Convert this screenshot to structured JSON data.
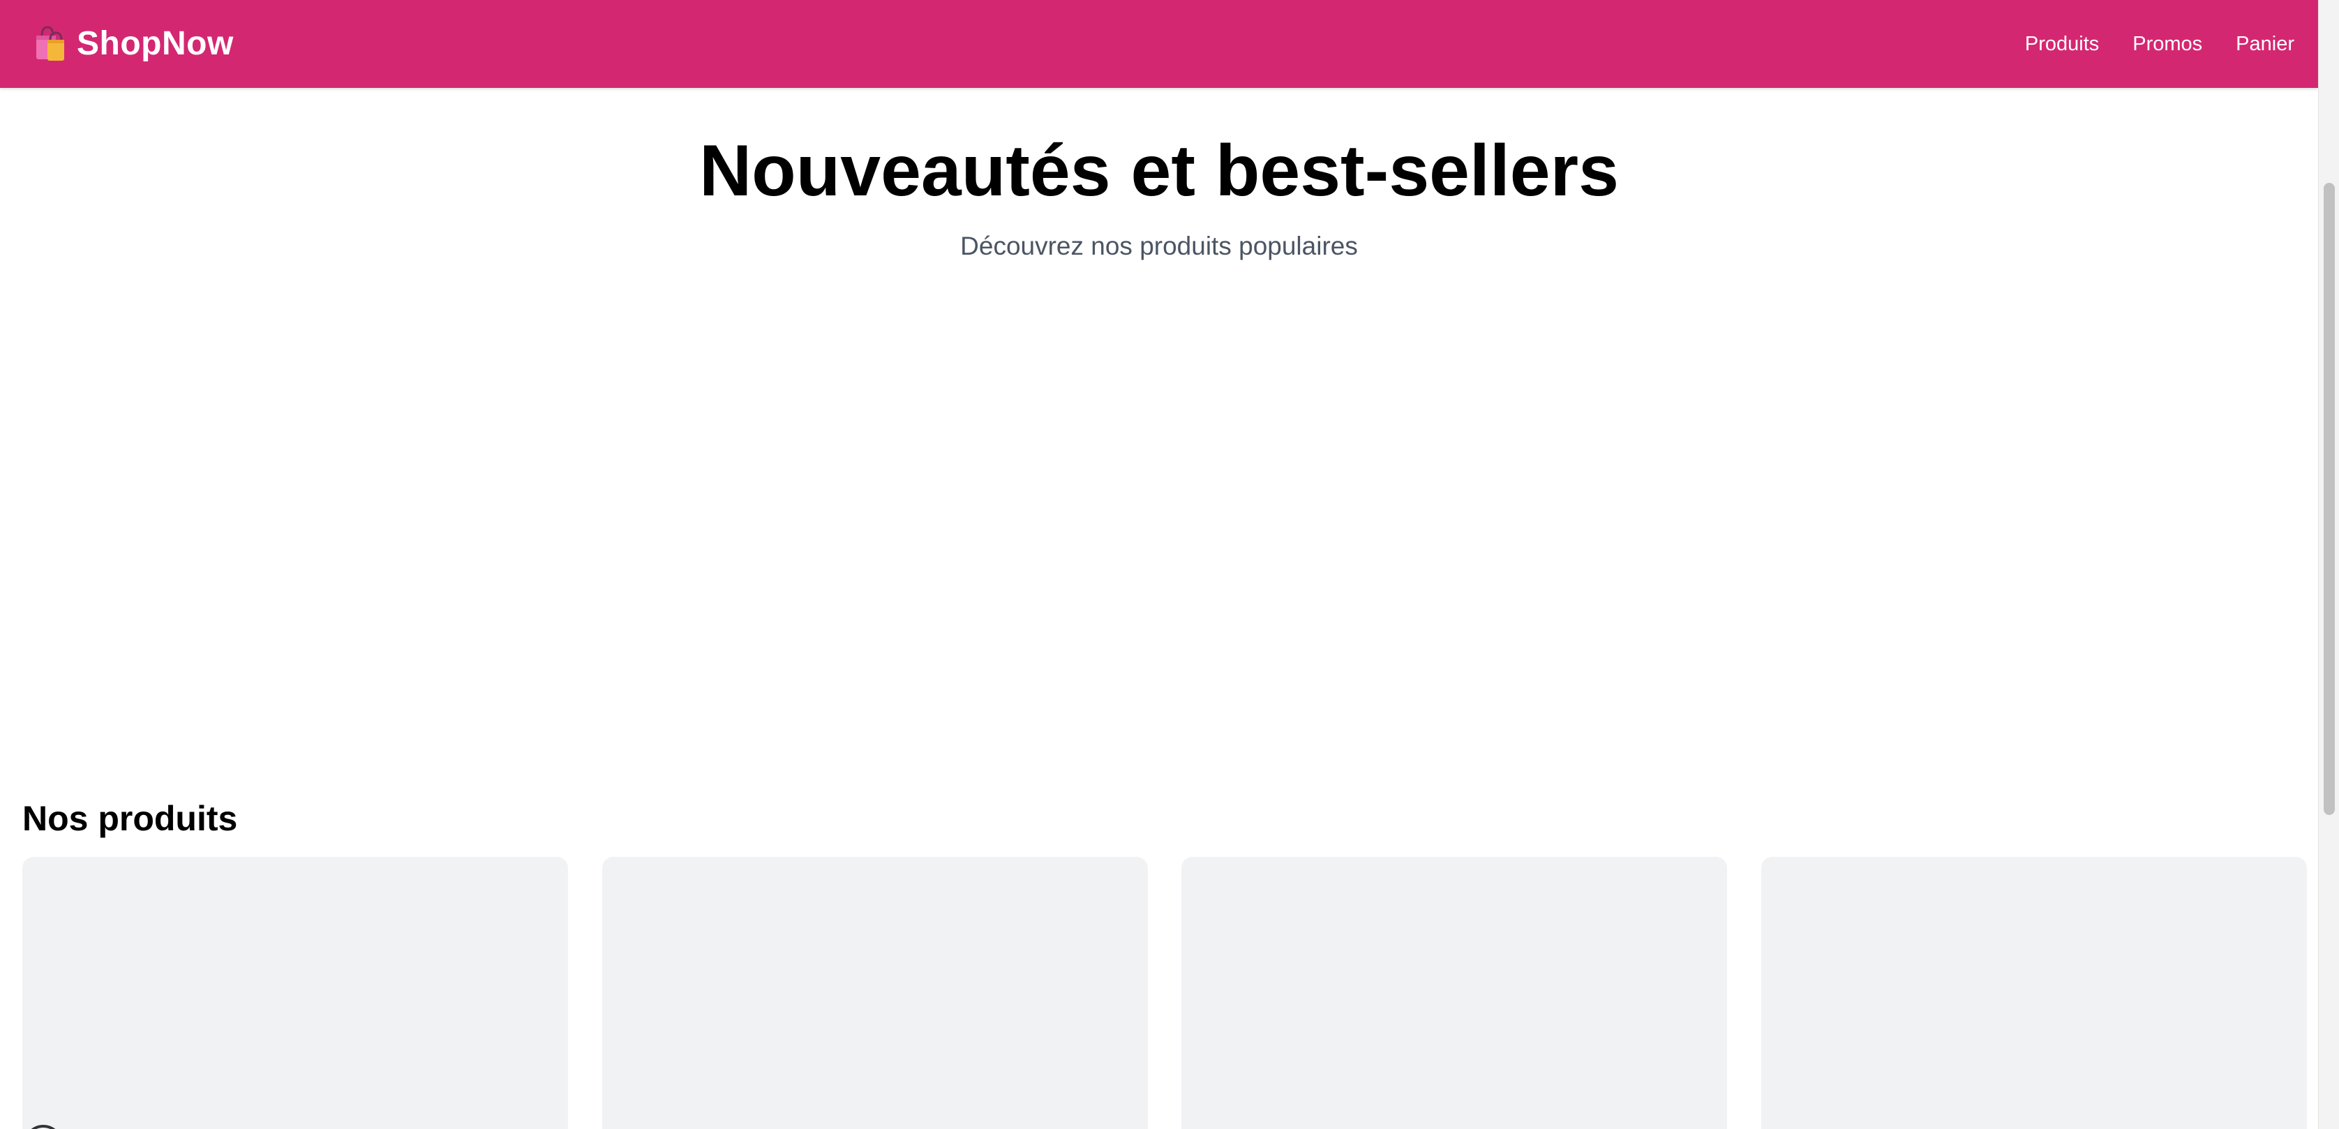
{
  "navbar": {
    "brand_text": "ShopNow",
    "brand_icon": "shopping-bags-icon",
    "links": [
      {
        "label": "Produits"
      },
      {
        "label": "Promos"
      },
      {
        "label": "Panier"
      }
    ],
    "background_color": "#d42772"
  },
  "hero": {
    "title": "Nouveautés et best-sellers",
    "subtitle": "Découvrez nos produits populaires"
  },
  "products_section": {
    "title": "Nos produits",
    "card_count": 4
  }
}
